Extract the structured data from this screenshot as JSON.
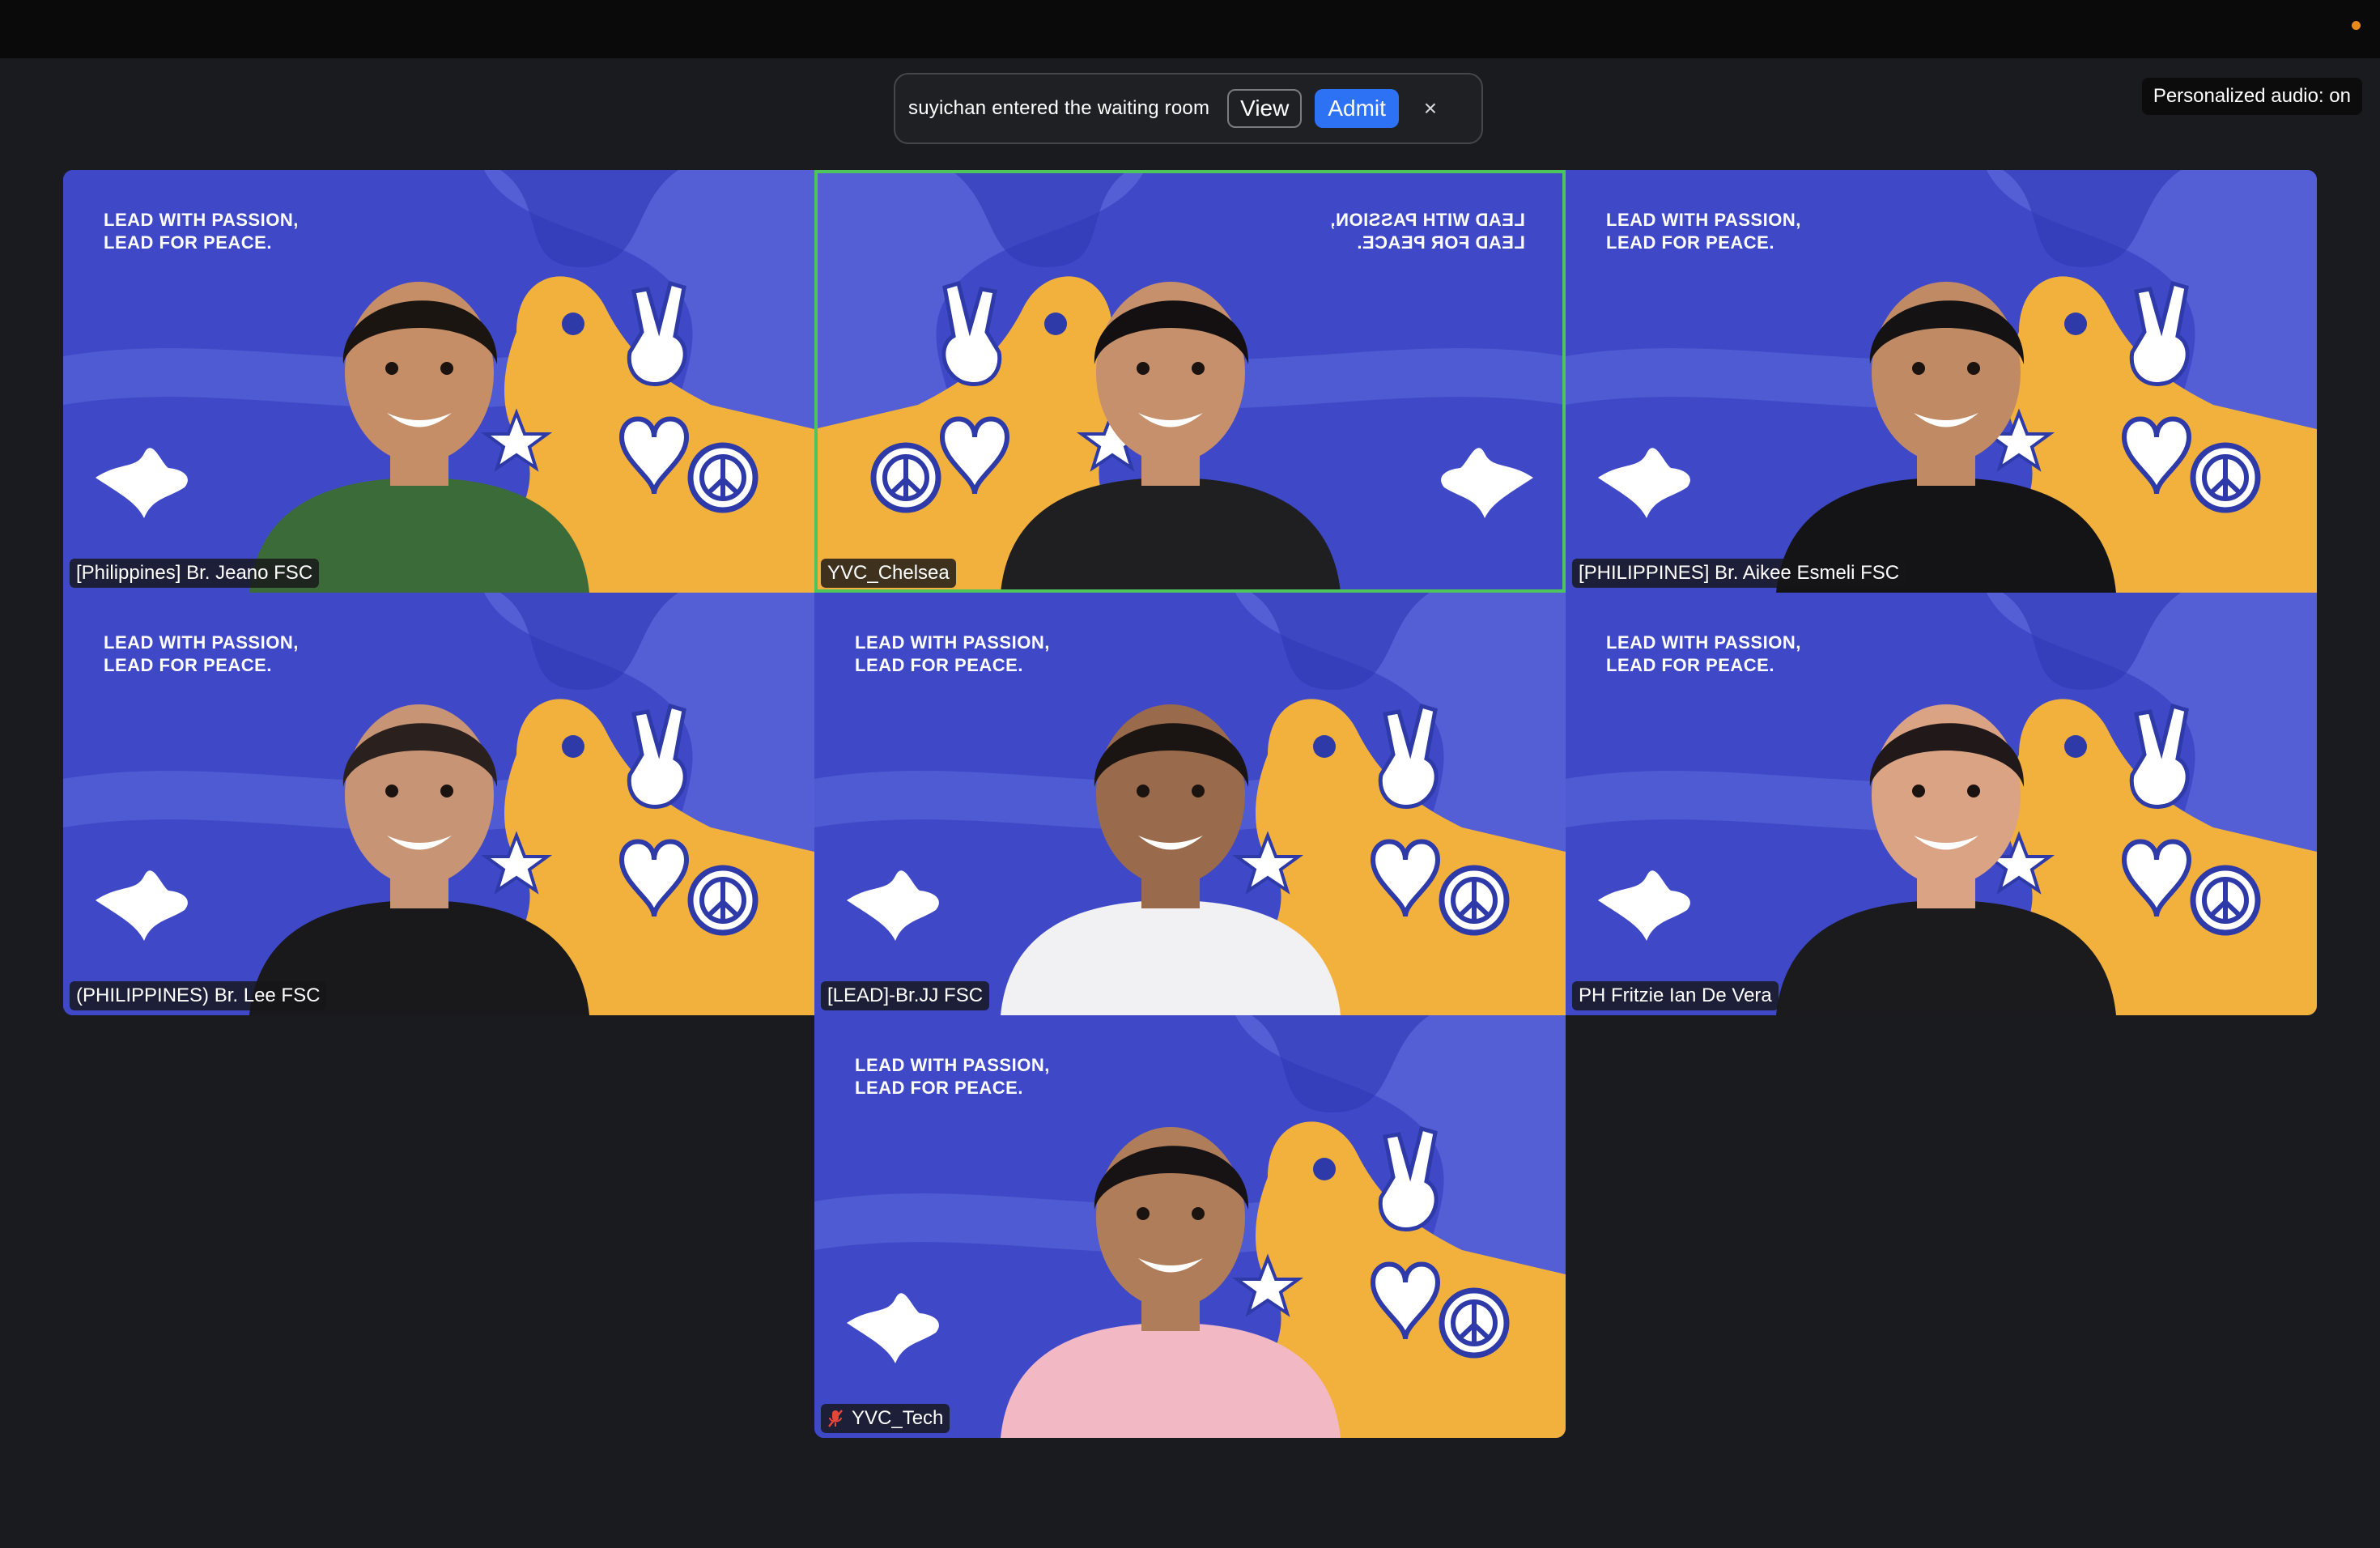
{
  "notification": {
    "message": "suyichan entered the waiting room",
    "view_label": "View",
    "admit_label": "Admit",
    "close_glyph": "×"
  },
  "audio_status": "Personalized audio: on",
  "background_slogan": [
    "LEAD WITH PASSION,",
    "LEAD FOR PEACE."
  ],
  "colors": {
    "background": "#1a1b1e",
    "tile_blue": "#3f49c8",
    "tile_yellow": "#f2b13c",
    "active_speaker": "#4ec45c",
    "admit_button": "#2d72f5",
    "recording_dot": "#e8891c"
  },
  "participants": [
    {
      "name": "[Philippines] Br. Jeano FSC",
      "muted": false,
      "active": false,
      "shirt": "#3c6b3a",
      "skin": "#c58e66",
      "hair": "#1b1512"
    },
    {
      "name": "YVC_Chelsea",
      "muted": false,
      "active": true,
      "shirt": "#1f1f22",
      "skin": "#c6906c",
      "hair": "#141012"
    },
    {
      "name": "[PHILIPPINES] Br. Aikee Esmeli FSC",
      "muted": false,
      "active": false,
      "shirt": "#141416",
      "skin": "#bf8a64",
      "hair": "#151214"
    },
    {
      "name": "(PHILIPPINES) Br. Lee FSC",
      "muted": false,
      "active": false,
      "shirt": "#19191b",
      "skin": "#c89476",
      "hair": "#2a211e"
    },
    {
      "name": "[LEAD]-Br.JJ FSC",
      "muted": false,
      "active": false,
      "shirt": "#f1f1f3",
      "skin": "#9a6a4c",
      "hair": "#1a1412"
    },
    {
      "name": "PH Fritzie Ian De Vera",
      "muted": false,
      "active": false,
      "shirt": "#1b1a1c",
      "skin": "#d9a384",
      "hair": "#201819"
    },
    {
      "name": "YVC_Tech",
      "muted": true,
      "active": false,
      "shirt": "#f2b8c4",
      "skin": "#b07d5b",
      "hair": "#171213"
    }
  ]
}
